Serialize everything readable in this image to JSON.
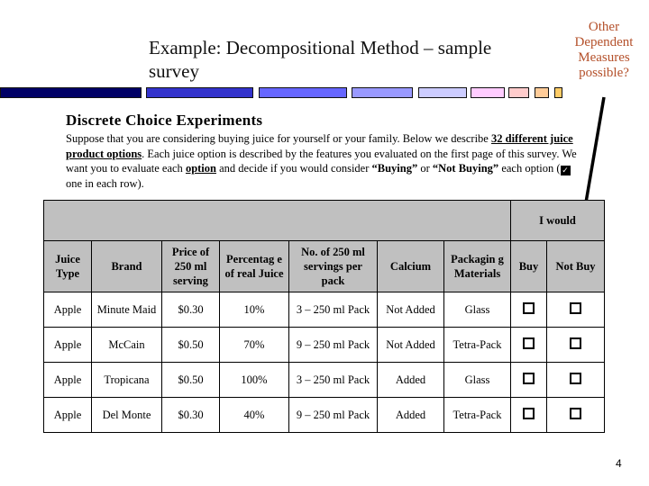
{
  "slide": {
    "title": "Example: Decompositional Method – sample survey",
    "annotation": "Other Dependent Measures possible?",
    "page_number": "4",
    "bar_colors": [
      "#000066",
      "#3333cc",
      "#6666ff",
      "#9999ff",
      "#ccccff",
      "#ffccff",
      "#ffcccc",
      "#ffcc99",
      "#ffcc66"
    ]
  },
  "survey": {
    "heading": "Discrete Choice Experiments",
    "intro_1": "Suppose that you are considering buying juice for yourself or your family.  Below we describe ",
    "intro_bold_1": "32 different juice product options",
    "intro_2": ".  Each juice option is described by the features you evaluated on the first page of this survey.  We want you to evaluate each ",
    "intro_bold_2": "option",
    "intro_3": " and decide if you would consider ",
    "intro_bold_3": "“Buying”",
    "intro_4": " or ",
    "intro_bold_4": "“Not Buying”",
    "intro_5": " each option (",
    "intro_check": "✓",
    "intro_6": " one in each row).",
    "group_header": "I would",
    "columns": [
      "Juice Type",
      "Brand",
      "Price of 250 ml serving",
      "Percentag e of real Juice",
      "No. of 250 ml servings per pack",
      "Calcium",
      "Packagin g Materials",
      "Buy",
      "Not Buy"
    ],
    "rows": [
      {
        "type": "Apple",
        "brand": "Minute Maid",
        "price": "$0.30",
        "percent": "10%",
        "servings": "3 – 250 ml Pack",
        "calcium": "Not Added",
        "packaging": "Glass",
        "buy": false,
        "not_buy": false
      },
      {
        "type": "Apple",
        "brand": "McCain",
        "price": "$0.50",
        "percent": "70%",
        "servings": "9 – 250 ml Pack",
        "calcium": "Not Added",
        "packaging": "Tetra-Pack",
        "buy": false,
        "not_buy": false
      },
      {
        "type": "Apple",
        "brand": "Tropicana",
        "price": "$0.50",
        "percent": "100%",
        "servings": "3 – 250 ml Pack",
        "calcium": "Added",
        "packaging": "Glass",
        "buy": false,
        "not_buy": false
      },
      {
        "type": "Apple",
        "brand": "Del Monte",
        "price": "$0.30",
        "percent": "40%",
        "servings": "9 – 250 ml Pack",
        "calcium": "Added",
        "packaging": "Tetra-Pack",
        "buy": false,
        "not_buy": false
      }
    ]
  }
}
